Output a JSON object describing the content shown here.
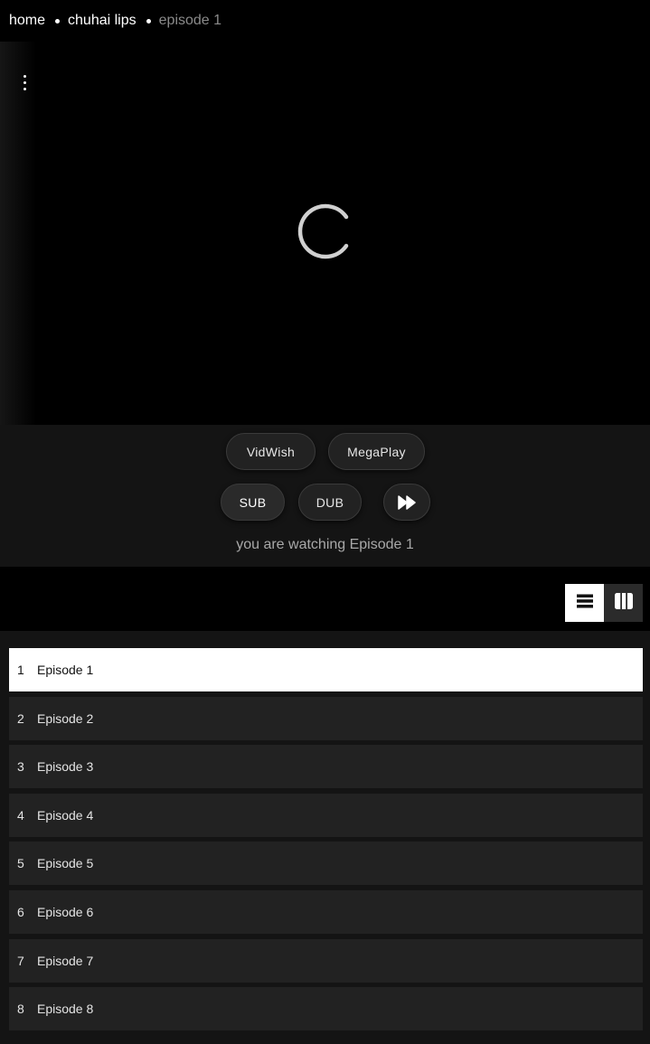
{
  "breadcrumb": {
    "home": "home",
    "series": "chuhai lips",
    "current": "episode 1"
  },
  "player": {
    "menu_icon": "kebab-menu-icon",
    "loading_icon": "loading-spinner-icon"
  },
  "servers": [
    {
      "label": "VidWish"
    },
    {
      "label": "MegaPlay"
    }
  ],
  "audio": {
    "sub_label": "SUB",
    "dub_label": "DUB",
    "skip_icon": "fast-forward-icon"
  },
  "status": {
    "watching_text": "you are watching Episode 1"
  },
  "episode_view": {
    "list_icon": "list-view-icon",
    "grid_icon": "grid-view-icon"
  },
  "episodes": [
    {
      "number": "1",
      "title": "Episode 1",
      "active": true
    },
    {
      "number": "2",
      "title": "Episode 2",
      "active": false
    },
    {
      "number": "3",
      "title": "Episode 3",
      "active": false
    },
    {
      "number": "4",
      "title": "Episode 4",
      "active": false
    },
    {
      "number": "5",
      "title": "Episode 5",
      "active": false
    },
    {
      "number": "6",
      "title": "Episode 6",
      "active": false
    },
    {
      "number": "7",
      "title": "Episode 7",
      "active": false
    },
    {
      "number": "8",
      "title": "Episode 8",
      "active": false
    }
  ],
  "colors": {
    "background": "#000000",
    "panel": "#141414",
    "row": "#222222",
    "active_row": "#ffffff"
  }
}
